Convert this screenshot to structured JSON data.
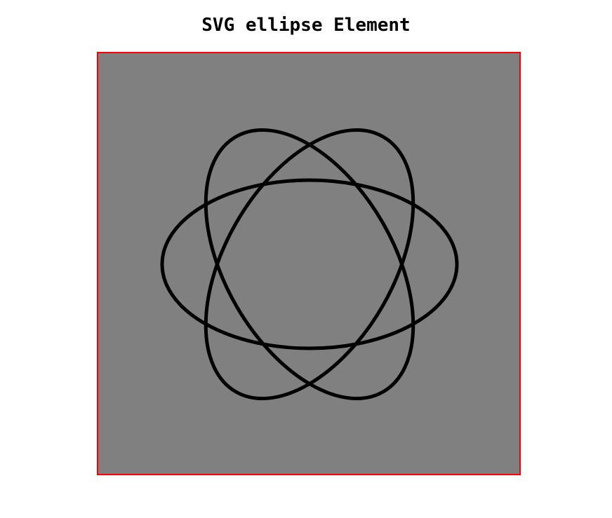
{
  "page": {
    "title": "SVG ellipse Element"
  },
  "colors": {
    "background": "#808080",
    "border": "#ff0000",
    "stroke": "#000000"
  },
  "figure": {
    "shape": "ellipse",
    "count": 3,
    "rotations_deg": [
      0,
      60,
      120
    ]
  }
}
